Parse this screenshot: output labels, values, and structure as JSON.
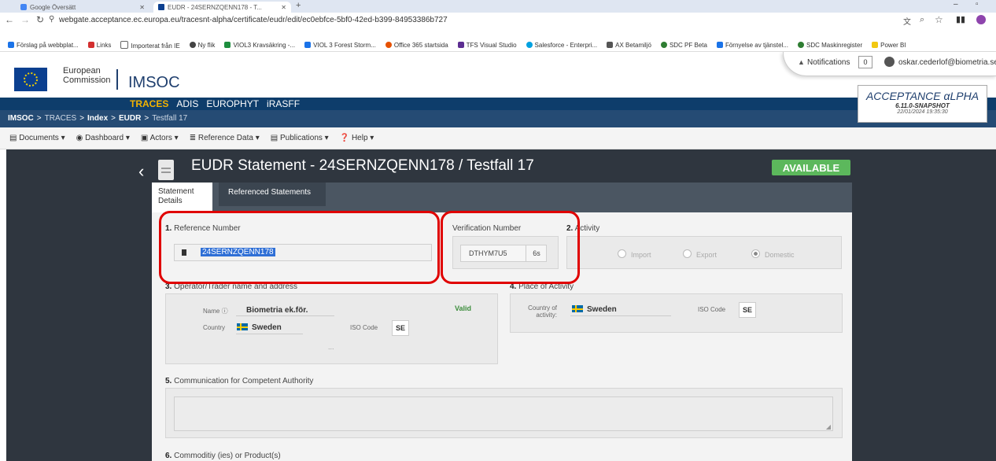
{
  "browser": {
    "tabs": [
      {
        "label": "Google Översätt"
      },
      {
        "label": "EUDR - 24SERNZQENN178 - T..."
      }
    ],
    "url": "webgate.acceptance.ec.europa.eu/tracesnt-alpha/certificate/eudr/edit/ec0ebfce-5bf0-42ed-b399-84953386b727",
    "bookmarks": [
      {
        "label": "Förslag på webbplat...",
        "color": "#1a73e8"
      },
      {
        "label": "Links",
        "color": "#d32f2f"
      },
      {
        "label": "Importerat från IE",
        "color": "#666666"
      },
      {
        "label": "Ny flik",
        "color": "#444444"
      },
      {
        "label": "VIOL3 Kravsäkring -...",
        "color": "#1e8e3e"
      },
      {
        "label": "VIOL 3 Forest Storm...",
        "color": "#1a73e8"
      },
      {
        "label": "Office 365 startsida",
        "color": "#e65100"
      },
      {
        "label": "TFS Visual Studio",
        "color": "#5c2d91"
      },
      {
        "label": "Salesforce - Enterpri...",
        "color": "#00a1e0"
      },
      {
        "label": "AX Betamiljö",
        "color": "#555555"
      },
      {
        "label": "SDC PF Beta",
        "color": "#2e7d32"
      },
      {
        "label": "Förnyelse av tjänstel...",
        "color": "#1a73e8"
      },
      {
        "label": "SDC Maskinregister",
        "color": "#2e7d32"
      },
      {
        "label": "Power BI",
        "color": "#f2c811"
      }
    ]
  },
  "header": {
    "ec_line1": "European",
    "ec_line2": "Commission",
    "imsoc": "IMSOC",
    "notifications_label": "Notifications",
    "notifications_count": "0",
    "user_email": "oskar.cederlof@biometria.se",
    "apps": [
      "TRACES",
      "ADIS",
      "EUROPHYT",
      "iRASFF"
    ],
    "breadcrumbs": [
      "IMSOC",
      "TRACES",
      "Index",
      "EUDR",
      "Testfall 17"
    ],
    "env_title": "ACCEPTANCE αLPHA",
    "env_version": "6.11.0-SNAPSHOT",
    "env_date": "22/01/2024 19:35:30"
  },
  "menu": {
    "items": [
      "Documents",
      "Dashboard",
      "Actors",
      "Reference Data",
      "Publications",
      "Help"
    ]
  },
  "page": {
    "title": "EUDR Statement - 24SERNZQENN178 / Testfall 17",
    "status": "AVAILABLE",
    "tabs": [
      "Statement Details",
      "Referenced Statements"
    ]
  },
  "form": {
    "ref_num": "1.",
    "ref_label": "Reference Number",
    "ref_value": "24SERNZQENN178",
    "verif_label": "Verification Number",
    "verif_value": "DTHYM7U5",
    "verif_suffix": "6s",
    "act_num": "2.",
    "act_label": "Activity",
    "activity_options": [
      "Import",
      "Export",
      "Domestic"
    ],
    "op_num": "3.",
    "op_label": "Operator/Trader name and address",
    "name_label": "Name",
    "name_value": "Biometria ek.för.",
    "valid": "Valid",
    "country_label": "Country",
    "country_value": "Sweden",
    "iso_label": "ISO Code",
    "iso_value": "SE",
    "more": "...",
    "place_num": "4.",
    "place_label": "Place of Activity",
    "coa_label": "Country of activity:",
    "coa_value": "Sweden",
    "coa_iso_label": "ISO Code",
    "coa_iso_value": "SE",
    "comm_num": "5.",
    "comm_label": "Communication for Competent Authority",
    "commodity_num": "6.",
    "commodity_label": "Commoditiy (ies) or Product(s)"
  },
  "colors": {
    "primary_dark": "#0e3d6b",
    "traces_yellow": "#f2b300",
    "available_green": "#5cb85c",
    "highlight_red": "#e00000"
  }
}
